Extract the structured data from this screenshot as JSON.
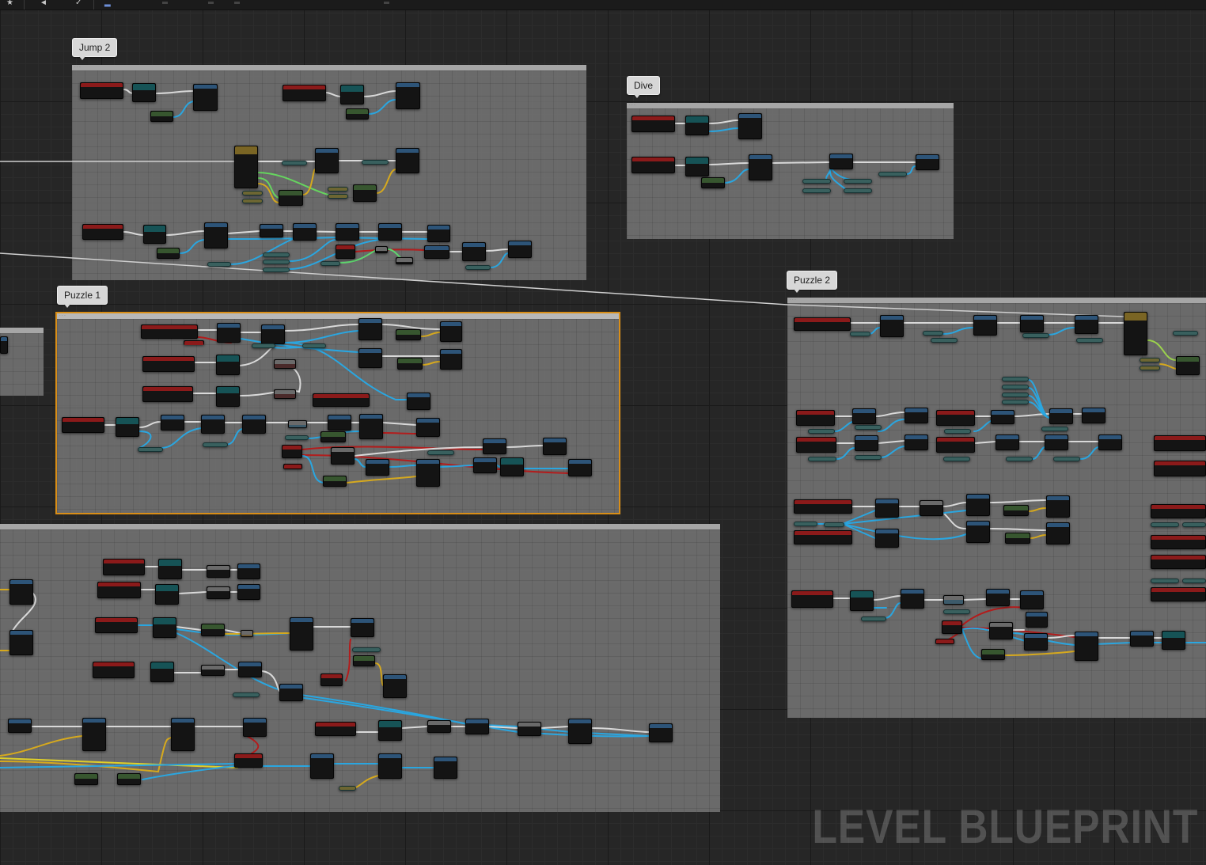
{
  "toolbar": {
    "icons": [
      "star-icon",
      "compile-icon",
      "cursor-icon",
      "chart-icon",
      "dot-icon",
      "dot-icon",
      "dot-icon",
      "dot-icon"
    ]
  },
  "comments": {
    "jump2": {
      "label": "Jump 2"
    },
    "dive": {
      "label": "Dive"
    },
    "puzzle2": {
      "label": "Puzzle 2"
    },
    "puzzle1": {
      "label": "Puzzle 1"
    }
  },
  "watermark": "LEVEL BLUEPRINT",
  "colors": {
    "exec_wire": "#d9d9d9",
    "object_wire": "#2aa6e0",
    "bool_wire": "#b31c1c",
    "float_wire": "#d6a91e",
    "int_wire": "#5fd66f",
    "selection_outline": "#d98e17",
    "event_header": "#8b1a1a",
    "function_header": "#2d5478",
    "cast_header": "#165356",
    "pure_header": "#37562f",
    "macro_header": "#7a6524",
    "graph_background": "#262626"
  }
}
